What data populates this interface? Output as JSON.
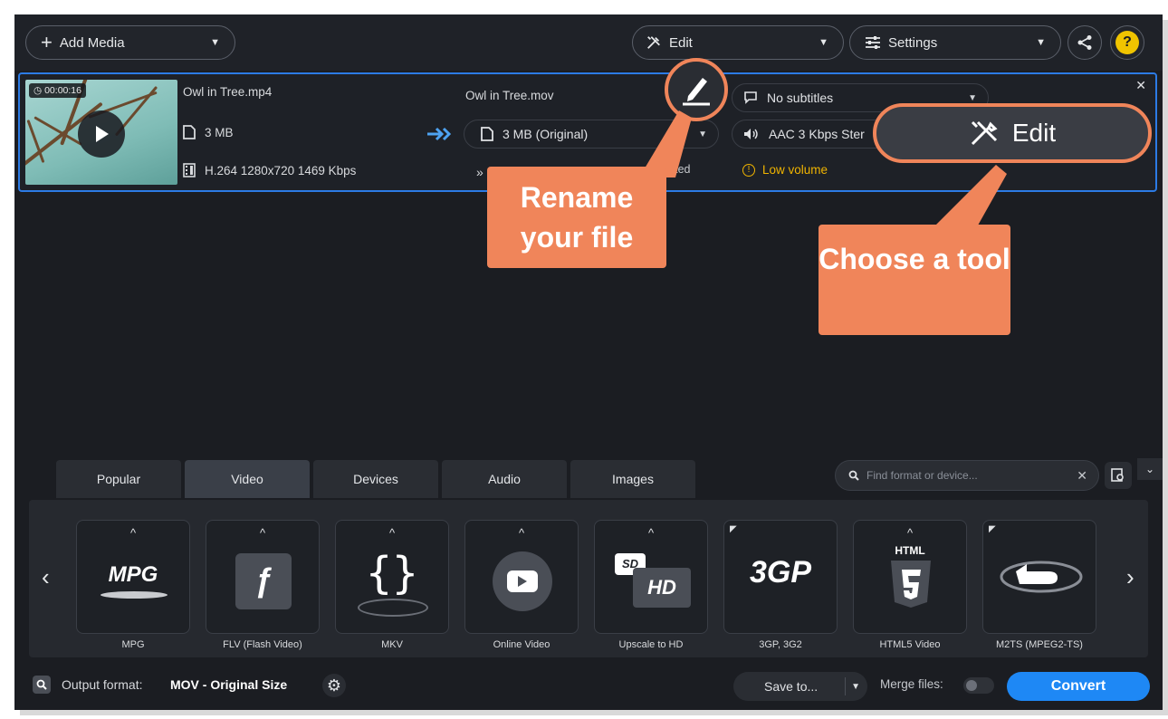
{
  "header": {
    "add_media_label": "Add Media",
    "edit_label": "Edit",
    "settings_label": "Settings",
    "help_label": "?"
  },
  "file": {
    "duration": "00:00:16",
    "source_name": "Owl in Tree.mp4",
    "source_size": "3 MB",
    "source_codec": "H.264 1280x720 1469 Kbps",
    "output_name": "Owl in Tree.mov",
    "output_size": "3 MB (Original)",
    "hw_status": "orted",
    "subtitles": "No subtitles",
    "audio": "AAC 3 Kbps Ster",
    "warning": "Low volume"
  },
  "callouts": {
    "rename": "Rename your file",
    "choose": "Choose a tool",
    "edit_button": "Edit"
  },
  "tabs": [
    "Popular",
    "Video",
    "Devices",
    "Audio",
    "Images"
  ],
  "active_tab": "Video",
  "search": {
    "placeholder": "Find format or device..."
  },
  "formats": [
    {
      "label": "MPG"
    },
    {
      "label": "FLV (Flash Video)"
    },
    {
      "label": "MKV"
    },
    {
      "label": "Online Video"
    },
    {
      "label": "Upscale to HD"
    },
    {
      "label": "3GP, 3G2"
    },
    {
      "label": "HTML5 Video"
    },
    {
      "label": "M2TS (MPEG2-TS)"
    }
  ],
  "footer": {
    "output_label": "Output format:",
    "output_value": "MOV - Original Size",
    "save_to": "Save to...",
    "merge_label": "Merge files:",
    "convert_label": "Convert"
  },
  "colors": {
    "accent": "#1e88f5",
    "callout": "#f0855a",
    "selection": "#2c7be5",
    "warning": "#f0b400"
  }
}
